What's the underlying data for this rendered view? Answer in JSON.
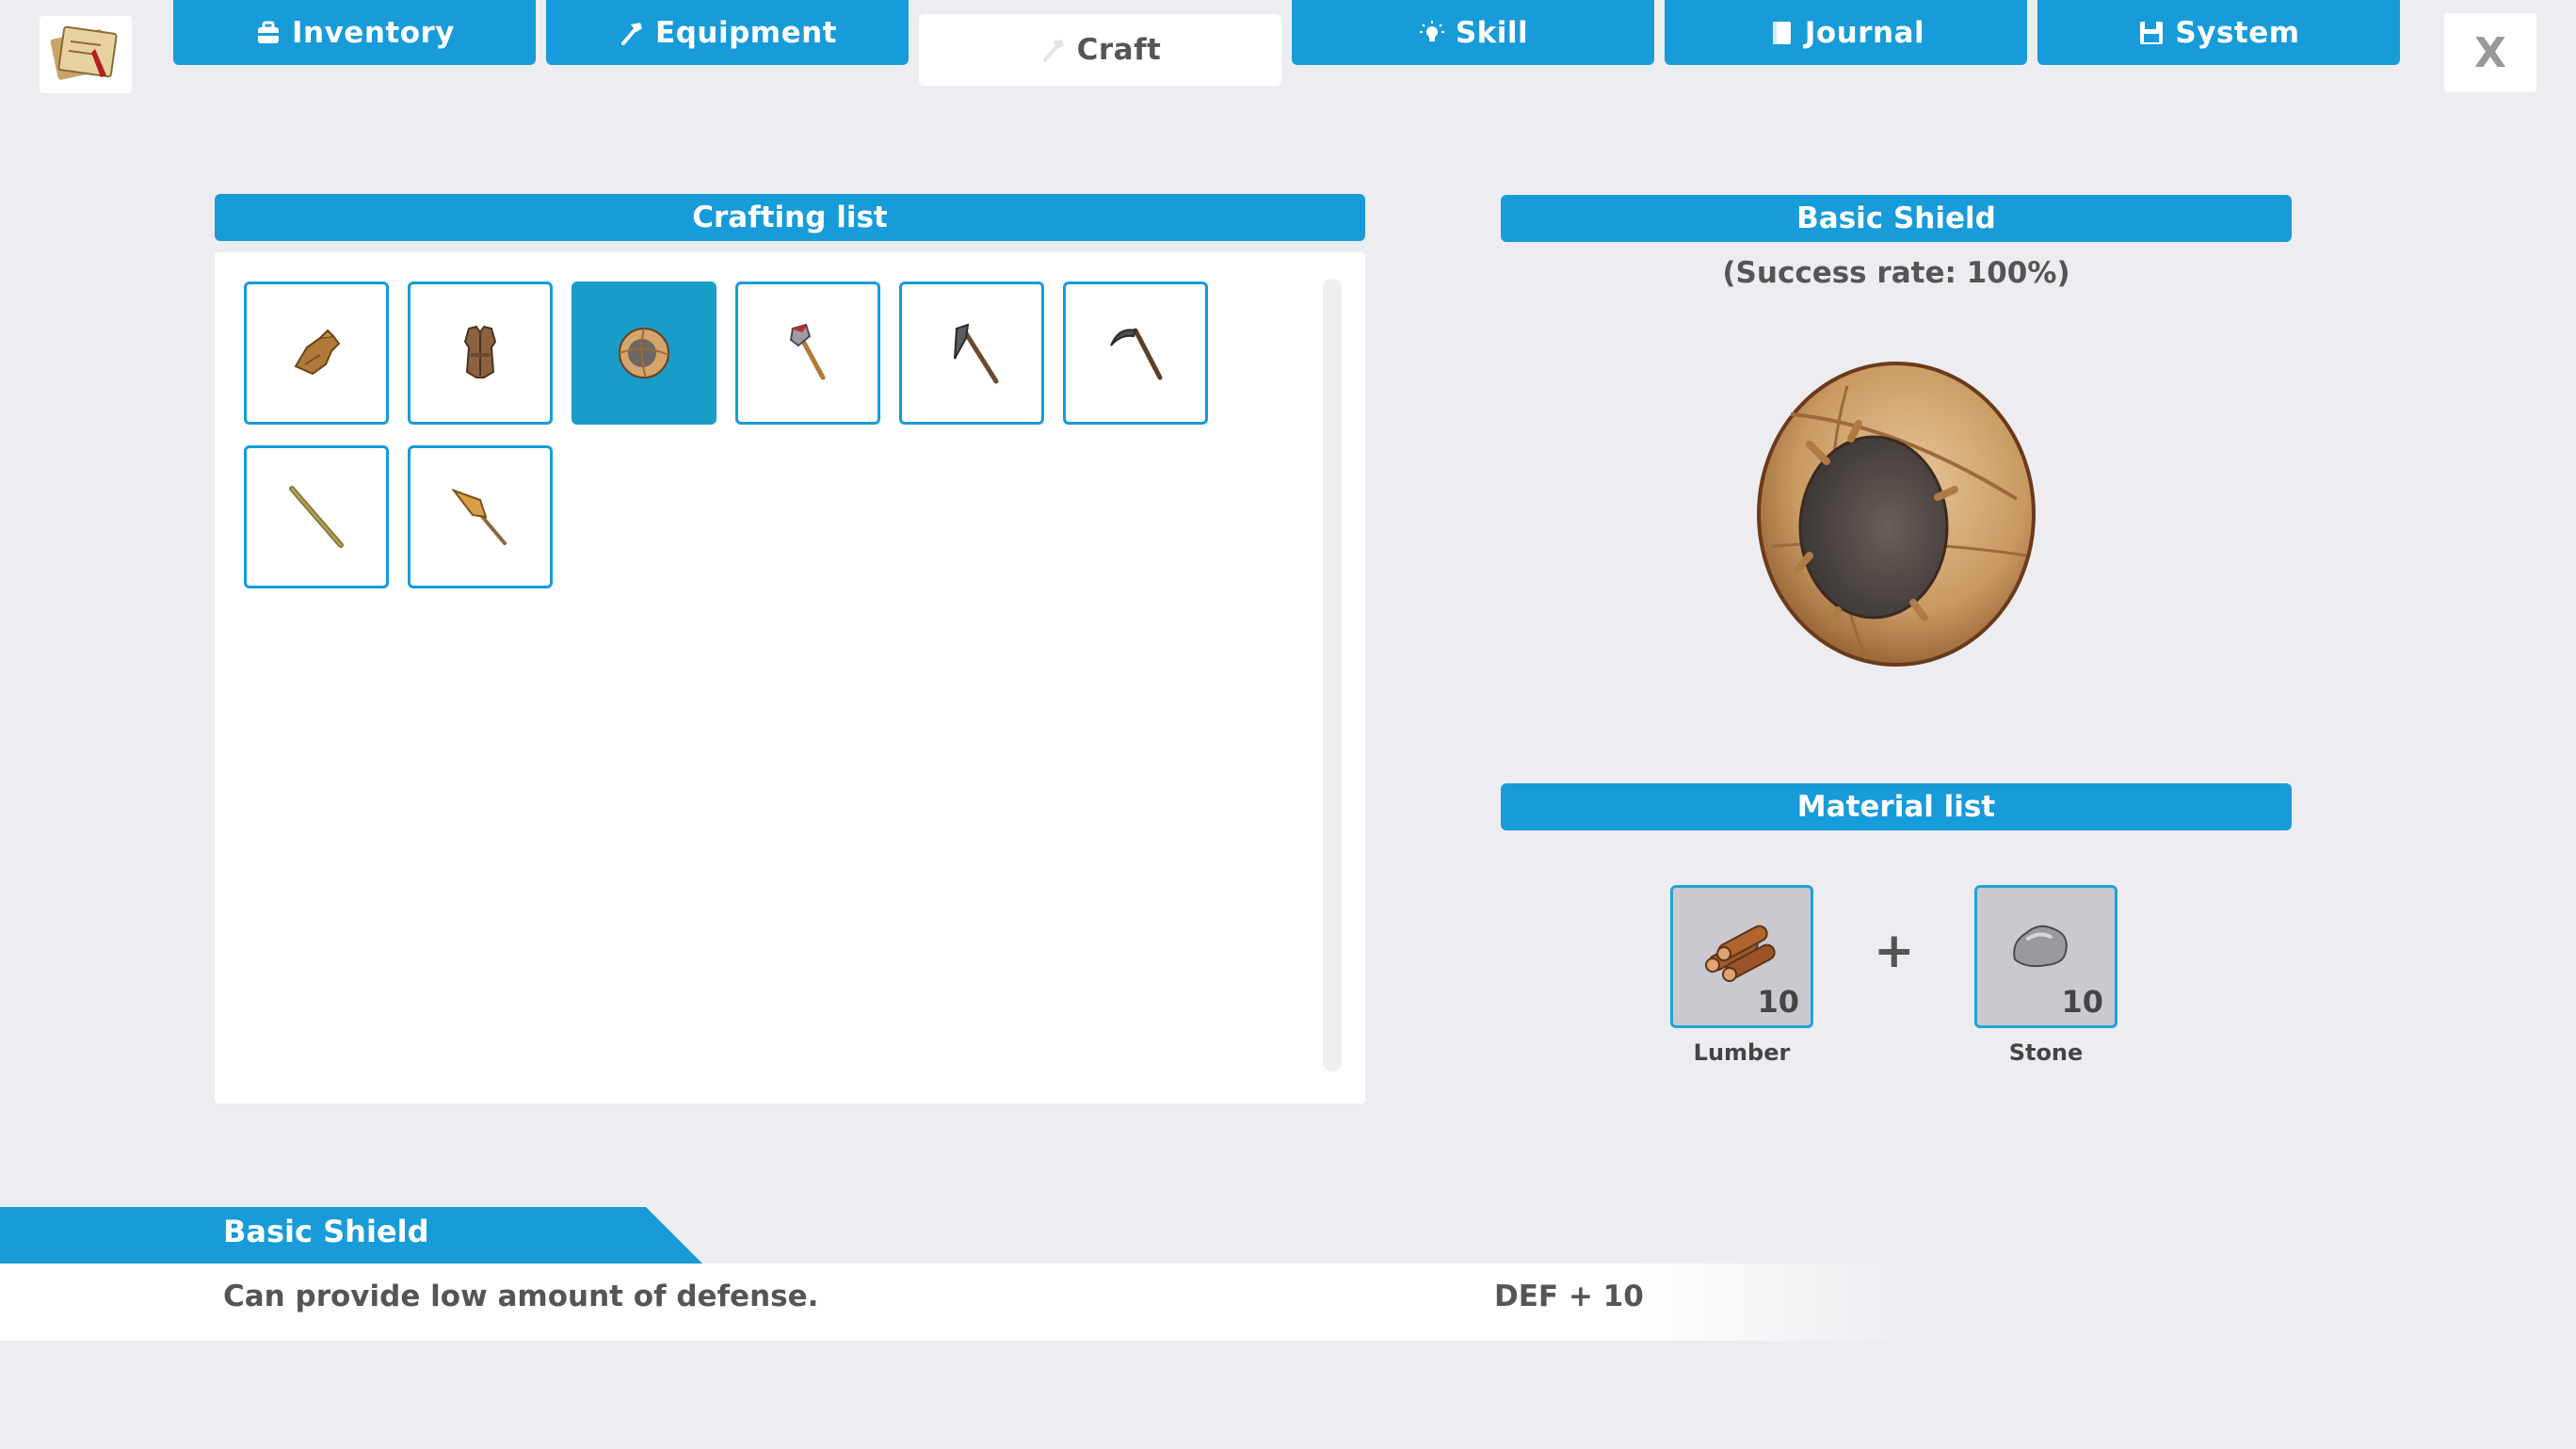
{
  "tabs": [
    {
      "label": "Inventory",
      "icon": "backpack-icon"
    },
    {
      "label": "Equipment",
      "icon": "hammer-icon"
    },
    {
      "label": "Craft",
      "icon": "hammer-icon"
    },
    {
      "label": "Skill",
      "icon": "lightbulb-icon"
    },
    {
      "label": "Journal",
      "icon": "notebook-icon"
    },
    {
      "label": "System",
      "icon": "save-icon"
    }
  ],
  "active_tab": "Craft",
  "close_label": "X",
  "crafting": {
    "title": "Crafting list",
    "items": [
      {
        "name": "glove-icon"
      },
      {
        "name": "leather-vest-icon"
      },
      {
        "name": "basic-shield-icon",
        "selected": true
      },
      {
        "name": "axe-icon"
      },
      {
        "name": "pickaxe-icon"
      },
      {
        "name": "sickle-icon"
      },
      {
        "name": "wooden-stick-icon"
      },
      {
        "name": "spear-icon"
      }
    ]
  },
  "detail": {
    "title": "Basic Shield",
    "success": "(Success rate: 100%)",
    "materials_title": "Material list",
    "materials": [
      {
        "label": "Lumber",
        "count": "10",
        "icon": "lumber-icon"
      },
      {
        "label": "Stone",
        "count": "10",
        "icon": "stone-icon"
      }
    ],
    "plus": "+"
  },
  "info": {
    "title": "Basic Shield",
    "description": "Can provide low amount of defense.",
    "stat": "DEF + 10"
  },
  "colors": {
    "accent": "#189bd9",
    "selected_slot": "#1a9cc8",
    "background": "#edecf0"
  }
}
